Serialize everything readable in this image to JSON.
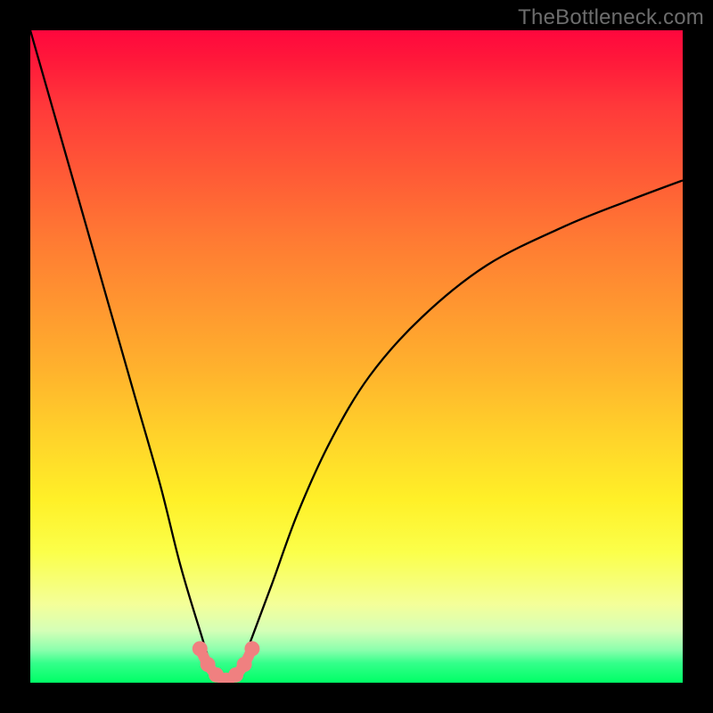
{
  "watermark": "TheBottleneck.com",
  "chart_data": {
    "type": "line",
    "title": "",
    "xlabel": "",
    "ylabel": "",
    "xlim": [
      0,
      100
    ],
    "ylim": [
      0,
      100
    ],
    "grid": false,
    "legend": false,
    "series": [
      {
        "name": "bottleneck-curve",
        "description": "V-shaped bottleneck curve; minimum near x≈30 where curve touches y≈0, rising steeply toward y≈100 at x=0 and asymptotically toward ~75 at x=100",
        "x": [
          0,
          4,
          8,
          12,
          16,
          20,
          23,
          26,
          28,
          30,
          32,
          34,
          37,
          41,
          46,
          52,
          60,
          70,
          82,
          92,
          100
        ],
        "values": [
          100,
          86,
          72,
          58,
          44,
          30,
          18,
          8,
          2,
          0,
          2,
          7,
          15,
          26,
          37,
          47,
          56,
          64,
          70,
          74,
          77
        ]
      }
    ],
    "markers": {
      "name": "highlight-region",
      "color": "#f08080",
      "x": [
        26,
        27.2,
        28.5,
        30,
        31.5,
        32.8,
        34
      ],
      "values": [
        5.2,
        2.8,
        1.2,
        0.4,
        1.2,
        2.8,
        5.2
      ]
    },
    "background_gradient": {
      "type": "vertical",
      "stops": [
        {
          "pos": 0,
          "color": "#ff073d"
        },
        {
          "pos": 50,
          "color": "#ffb22d"
        },
        {
          "pos": 80,
          "color": "#fbff4a"
        },
        {
          "pos": 100,
          "color": "#00ff66"
        }
      ]
    }
  }
}
